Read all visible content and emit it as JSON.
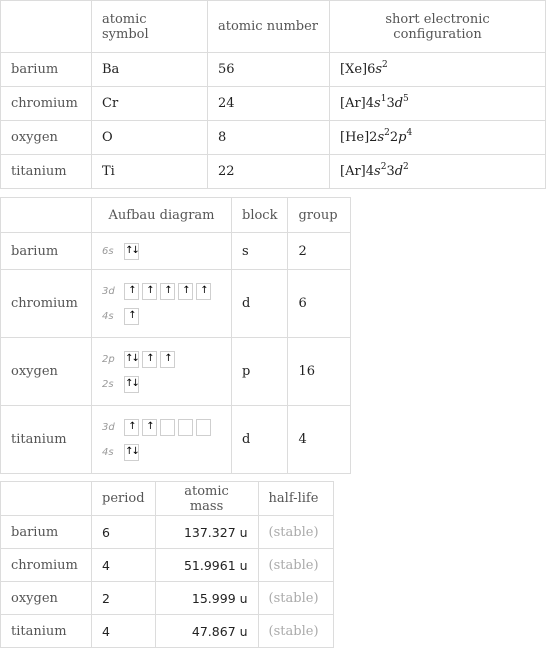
{
  "table1": {
    "headers": [
      "",
      "atomic symbol",
      "atomic number",
      "short electronic configuration"
    ],
    "rows": [
      {
        "name": "barium",
        "symbol": "Ba",
        "number": "56",
        "config": [
          {
            "t": "[Xe]6"
          },
          {
            "i": "s"
          },
          {
            "sup": "2"
          }
        ]
      },
      {
        "name": "chromium",
        "symbol": "Cr",
        "number": "24",
        "config": [
          {
            "t": "[Ar]4"
          },
          {
            "i": "s"
          },
          {
            "sup": "1"
          },
          {
            "t": "3"
          },
          {
            "i": "d"
          },
          {
            "sup": "5"
          }
        ]
      },
      {
        "name": "oxygen",
        "symbol": "O",
        "number": "8",
        "config": [
          {
            "t": "[He]2"
          },
          {
            "i": "s"
          },
          {
            "sup": "2"
          },
          {
            "t": "2"
          },
          {
            "i": "p"
          },
          {
            "sup": "4"
          }
        ]
      },
      {
        "name": "titanium",
        "symbol": "Ti",
        "number": "22",
        "config": [
          {
            "t": "[Ar]4"
          },
          {
            "i": "s"
          },
          {
            "sup": "2"
          },
          {
            "t": "3"
          },
          {
            "i": "d"
          },
          {
            "sup": "2"
          }
        ]
      }
    ]
  },
  "table2": {
    "headers": [
      "",
      "Aufbau diagram",
      "block",
      "group"
    ],
    "rows": [
      {
        "name": "barium",
        "block": "s",
        "group": "2",
        "aufbau": [
          {
            "label": "6s",
            "boxes": [
              "updown"
            ]
          }
        ]
      },
      {
        "name": "chromium",
        "block": "d",
        "group": "6",
        "aufbau": [
          {
            "label": "3d",
            "boxes": [
              "up",
              "up",
              "up",
              "up",
              "up"
            ]
          },
          {
            "label": "4s",
            "boxes": [
              "up"
            ]
          }
        ]
      },
      {
        "name": "oxygen",
        "block": "p",
        "group": "16",
        "aufbau": [
          {
            "label": "2p",
            "boxes": [
              "updown",
              "up",
              "up"
            ]
          },
          {
            "label": "2s",
            "boxes": [
              "updown"
            ]
          }
        ]
      },
      {
        "name": "titanium",
        "block": "d",
        "group": "4",
        "aufbau": [
          {
            "label": "3d",
            "boxes": [
              "up",
              "up",
              "empty",
              "empty",
              "empty"
            ]
          },
          {
            "label": "4s",
            "boxes": [
              "updown"
            ]
          }
        ]
      }
    ]
  },
  "table3": {
    "headers": [
      "",
      "period",
      "atomic mass",
      "half-life"
    ],
    "rows": [
      {
        "name": "barium",
        "period": "6",
        "mass": "137.327 u",
        "halflife": "(stable)"
      },
      {
        "name": "chromium",
        "period": "4",
        "mass": "51.9961 u",
        "halflife": "(stable)"
      },
      {
        "name": "oxygen",
        "period": "2",
        "mass": "15.999 u",
        "halflife": "(stable)"
      },
      {
        "name": "titanium",
        "period": "4",
        "mass": "47.867 u",
        "halflife": "(stable)"
      }
    ]
  },
  "arrows": {
    "up": "↑",
    "updown": "↑↓",
    "empty": ""
  }
}
